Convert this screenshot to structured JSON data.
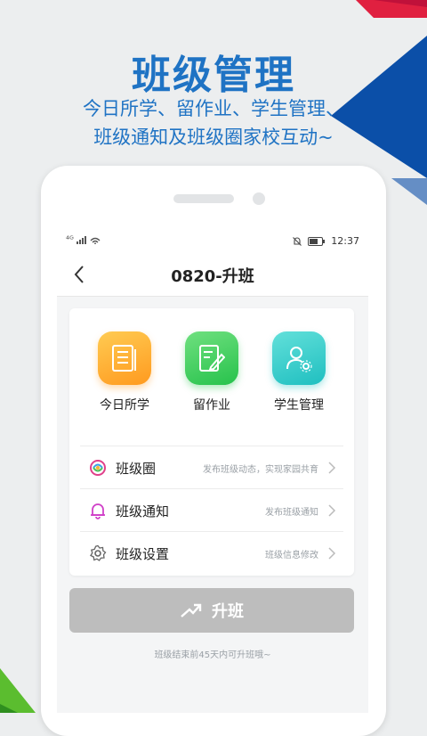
{
  "promo": {
    "title": "班级管理",
    "subtitle_line1": "今日所学、留作业、学生管理、",
    "subtitle_line2": "班级通知及班级圈家校互动~"
  },
  "status_bar": {
    "signal": "⁴ᴳ",
    "time": "12:37"
  },
  "nav": {
    "title": "0820-升班",
    "back_icon": "chevron-left-icon"
  },
  "features": [
    {
      "label": "今日所学",
      "icon": "document-icon",
      "color_from": "#ffcb52",
      "color_to": "#ff9a1f"
    },
    {
      "label": "留作业",
      "icon": "edit-note-icon",
      "color_from": "#6fe07f",
      "color_to": "#27c24c"
    },
    {
      "label": "学生管理",
      "icon": "user-settings-icon",
      "color_from": "#62e0da",
      "color_to": "#1fbfc0"
    }
  ],
  "menu": [
    {
      "label": "班级圈",
      "desc": "发布班级动态，实现家园共育",
      "icon": "circle-logo-icon"
    },
    {
      "label": "班级通知",
      "desc": "发布班级通知",
      "icon": "bell-icon"
    },
    {
      "label": "班级设置",
      "desc": "班级信息修改",
      "icon": "gear-icon"
    }
  ],
  "promote_button": {
    "label": "升班",
    "icon": "trend-up-arrow-icon",
    "color": "#bdbdbd"
  },
  "tip": "班级结束前45天内可升班哦~",
  "colors": {
    "brand_blue": "#1f73c4",
    "accent_red": "#e02040"
  }
}
